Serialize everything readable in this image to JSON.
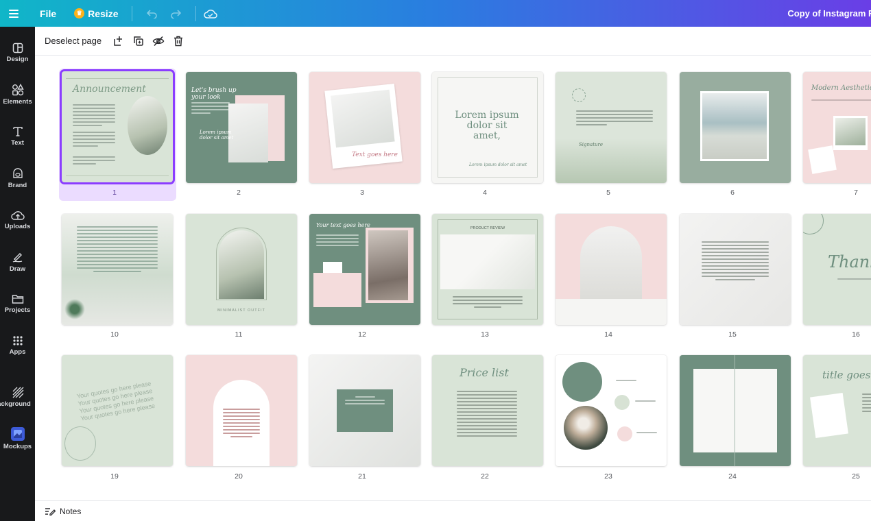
{
  "topbar": {
    "file_label": "File",
    "resize_label": "Resize",
    "doc_title": "Copy of Instagram F"
  },
  "sidebar": {
    "items": [
      {
        "label": "Design",
        "icon": "design-icon"
      },
      {
        "label": "Elements",
        "icon": "elements-icon"
      },
      {
        "label": "Text",
        "icon": "text-icon"
      },
      {
        "label": "Brand",
        "icon": "brand-icon"
      },
      {
        "label": "Uploads",
        "icon": "uploads-icon"
      },
      {
        "label": "Draw",
        "icon": "draw-icon"
      },
      {
        "label": "Projects",
        "icon": "projects-icon"
      },
      {
        "label": "Apps",
        "icon": "apps-icon"
      },
      {
        "label": "ackground",
        "icon": "background-icon"
      },
      {
        "label": "Mockups",
        "icon": "mockups-icon"
      }
    ]
  },
  "toolbar": {
    "deselect_label": "Deselect page"
  },
  "pages": [
    {
      "number": "1",
      "selected": true,
      "text": "Announcement"
    },
    {
      "number": "2",
      "text": "Let's brush up your look"
    },
    {
      "number": "3",
      "text": "Text goes here"
    },
    {
      "number": "4",
      "text": "Lorem ipsum dolor sit amet,"
    },
    {
      "number": "5",
      "text": ""
    },
    {
      "number": "6",
      "text": ""
    },
    {
      "number": "7",
      "text": "Modern Aesthetic"
    },
    {
      "number": "10",
      "text": ""
    },
    {
      "number": "11",
      "text": "MINIMALIST OUTFIT"
    },
    {
      "number": "12",
      "text": "Your text goes here"
    },
    {
      "number": "13",
      "text": "PRODUCT REVIEW"
    },
    {
      "number": "14",
      "text": ""
    },
    {
      "number": "15",
      "text": ""
    },
    {
      "number": "16",
      "text": "Thank y"
    },
    {
      "number": "19",
      "text": "Your quotes go here please"
    },
    {
      "number": "20",
      "text": ""
    },
    {
      "number": "21",
      "text": ""
    },
    {
      "number": "22",
      "text": "Price list"
    },
    {
      "number": "23",
      "text": ""
    },
    {
      "number": "24",
      "text": ""
    },
    {
      "number": "25",
      "text": "title goes"
    }
  ],
  "notes": {
    "label": "Notes"
  },
  "colors": {
    "sage": "#d9e4d7",
    "dark_green": "#6f8f7f",
    "blush": "#f4dcdc",
    "selection": "#8b3dff"
  }
}
